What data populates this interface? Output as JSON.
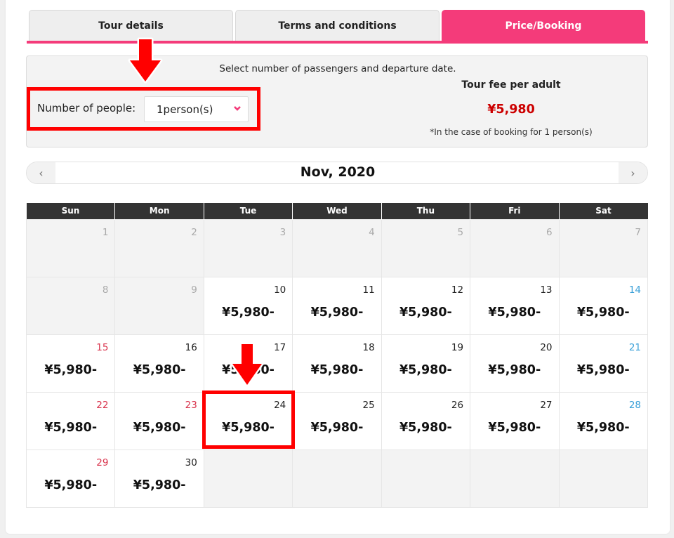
{
  "colors": {
    "accent": "#f43b7a",
    "price": "#cc0000",
    "sunday": "#d9334c",
    "saturday": "#3aa0d8",
    "annotation": "#ff0000"
  },
  "tabs": [
    {
      "label": "Tour details",
      "active": false
    },
    {
      "label": "Terms and conditions",
      "active": false
    },
    {
      "label": "Price/Booking",
      "active": true
    }
  ],
  "selection": {
    "instruction": "Select number of passengers and departure date.",
    "people_label": "Number of people:",
    "people_value": "1person(s)",
    "chevron_icon": "chevron-down-icon",
    "fee_title": "Tour fee per adult",
    "fee_price": "¥5,980",
    "fee_note": "*In the case of booking for 1 person(s)"
  },
  "calendar": {
    "month_title": "Nov, 2020",
    "prev_label": "‹",
    "next_label": "›",
    "weekdays": [
      "Sun",
      "Mon",
      "Tue",
      "Wed",
      "Thu",
      "Fri",
      "Sat"
    ],
    "weeks": [
      [
        {
          "day": "1",
          "state": "past",
          "type": "sun-gray"
        },
        {
          "day": "2",
          "state": "past"
        },
        {
          "day": "3",
          "state": "past"
        },
        {
          "day": "4",
          "state": "past"
        },
        {
          "day": "5",
          "state": "past"
        },
        {
          "day": "6",
          "state": "past"
        },
        {
          "day": "7",
          "state": "past"
        }
      ],
      [
        {
          "day": "8",
          "state": "past"
        },
        {
          "day": "9",
          "state": "past"
        },
        {
          "day": "10",
          "price": "¥5,980-"
        },
        {
          "day": "11",
          "price": "¥5,980-"
        },
        {
          "day": "12",
          "price": "¥5,980-"
        },
        {
          "day": "13",
          "price": "¥5,980-"
        },
        {
          "day": "14",
          "price": "¥5,980-",
          "type": "sat"
        }
      ],
      [
        {
          "day": "15",
          "price": "¥5,980-",
          "type": "sun"
        },
        {
          "day": "16",
          "price": "¥5,980-"
        },
        {
          "day": "17",
          "price": "¥5,980-"
        },
        {
          "day": "18",
          "price": "¥5,980-"
        },
        {
          "day": "19",
          "price": "¥5,980-"
        },
        {
          "day": "20",
          "price": "¥5,980-"
        },
        {
          "day": "21",
          "price": "¥5,980-",
          "type": "sat"
        }
      ],
      [
        {
          "day": "22",
          "price": "¥5,980-",
          "type": "sun"
        },
        {
          "day": "23",
          "price": "¥5,980-",
          "type": "hol"
        },
        {
          "day": "24",
          "price": "¥5,980-",
          "highlighted": true
        },
        {
          "day": "25",
          "price": "¥5,980-"
        },
        {
          "day": "26",
          "price": "¥5,980-"
        },
        {
          "day": "27",
          "price": "¥5,980-"
        },
        {
          "day": "28",
          "price": "¥5,980-",
          "type": "sat"
        }
      ],
      [
        {
          "day": "29",
          "price": "¥5,980-",
          "type": "sun"
        },
        {
          "day": "30",
          "price": "¥5,980-"
        },
        {
          "state": "empty"
        },
        {
          "state": "empty"
        },
        {
          "state": "empty"
        },
        {
          "state": "empty"
        },
        {
          "state": "empty"
        }
      ]
    ]
  },
  "annotations": [
    {
      "kind": "arrow-down",
      "target": "people-select"
    },
    {
      "kind": "arrow-down",
      "target": "calendar-day-24"
    }
  ]
}
